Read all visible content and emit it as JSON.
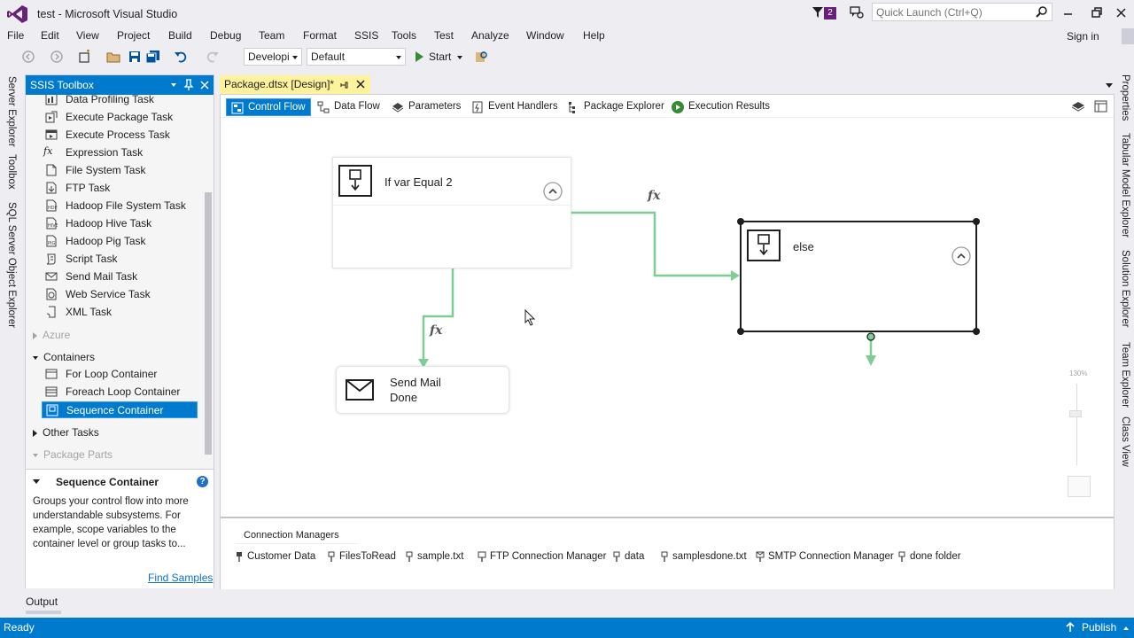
{
  "window": {
    "title": "test - Microsoft Visual Studio",
    "notification_count": "2",
    "quick_launch_placeholder": "Quick Launch (Ctrl+Q)",
    "sign_in": "Sign in"
  },
  "menu": [
    "File",
    "Edit",
    "View",
    "Project",
    "Build",
    "Debug",
    "Team",
    "Format",
    "SSIS",
    "Tools",
    "Test",
    "Analyze",
    "Window",
    "Help"
  ],
  "toolbar": {
    "config": "Developi",
    "platform": "Default",
    "start": "Start"
  },
  "left_tabs": [
    "Server Explorer",
    "Toolbox",
    "SQL Server Object Explorer"
  ],
  "right_tabs": [
    "Properties",
    "Tabular Model Explorer",
    "Solution Explorer",
    "Team Explorer",
    "Class View"
  ],
  "toolbox": {
    "title": "SSIS Toolbox",
    "items": [
      {
        "label": "Data Profiling Task",
        "icon": "data-profiling-icon"
      },
      {
        "label": "Execute Package Task",
        "icon": "execute-package-icon"
      },
      {
        "label": "Execute Process Task",
        "icon": "execute-process-icon"
      },
      {
        "label": "Expression Task",
        "icon": "fx-icon"
      },
      {
        "label": "File System Task",
        "icon": "file-system-icon"
      },
      {
        "label": "FTP Task",
        "icon": "ftp-icon"
      },
      {
        "label": "Hadoop File System Task",
        "icon": "hadoop-fs-icon"
      },
      {
        "label": "Hadoop Hive Task",
        "icon": "hadoop-hive-icon"
      },
      {
        "label": "Hadoop Pig Task",
        "icon": "hadoop-pig-icon"
      },
      {
        "label": "Script Task",
        "icon": "script-icon"
      },
      {
        "label": "Send Mail Task",
        "icon": "mail-icon"
      },
      {
        "label": "Web Service Task",
        "icon": "web-service-icon"
      },
      {
        "label": "XML Task",
        "icon": "xml-icon"
      }
    ],
    "azure": "Azure",
    "containers": "Containers",
    "container_items": [
      {
        "label": "For Loop Container",
        "icon": "for-loop-icon"
      },
      {
        "label": "Foreach Loop Container",
        "icon": "foreach-loop-icon"
      },
      {
        "label": "Sequence Container",
        "icon": "sequence-container-icon"
      }
    ],
    "other_tasks": "Other Tasks",
    "package_parts": "Package Parts",
    "desc_title": "Sequence Container",
    "desc_text": "Groups your control flow into more understandable subsystems. For example, scope variables to the container level or group tasks to...",
    "find_samples": "Find Samples"
  },
  "document": {
    "tab_title": "Package.dtsx [Design]*",
    "design_tabs": [
      "Control Flow",
      "Data Flow",
      "Parameters",
      "Event Handlers",
      "Package Explorer",
      "Execution Results"
    ],
    "nodes": {
      "if_container": "If var Equal 2",
      "else_container": "else",
      "send_mail_line1": "Send Mail",
      "send_mail_line2": "Done"
    },
    "fx_label": "fx",
    "zoom": "130%",
    "connection_managers_tab": "Connection Managers",
    "connection_managers": [
      "Customer Data",
      "FilesToRead",
      "sample.txt",
      "FTP Connection Manager",
      "data",
      "samplesdone.txt",
      "SMTP Connection Manager",
      "done folder"
    ]
  },
  "output_tab": "Output",
  "status": {
    "left": "Ready",
    "publish": "Publish"
  },
  "colors": {
    "accent": "#007acc",
    "doc_tab": "#fff29d",
    "precedence_green": "#7dcd95"
  }
}
